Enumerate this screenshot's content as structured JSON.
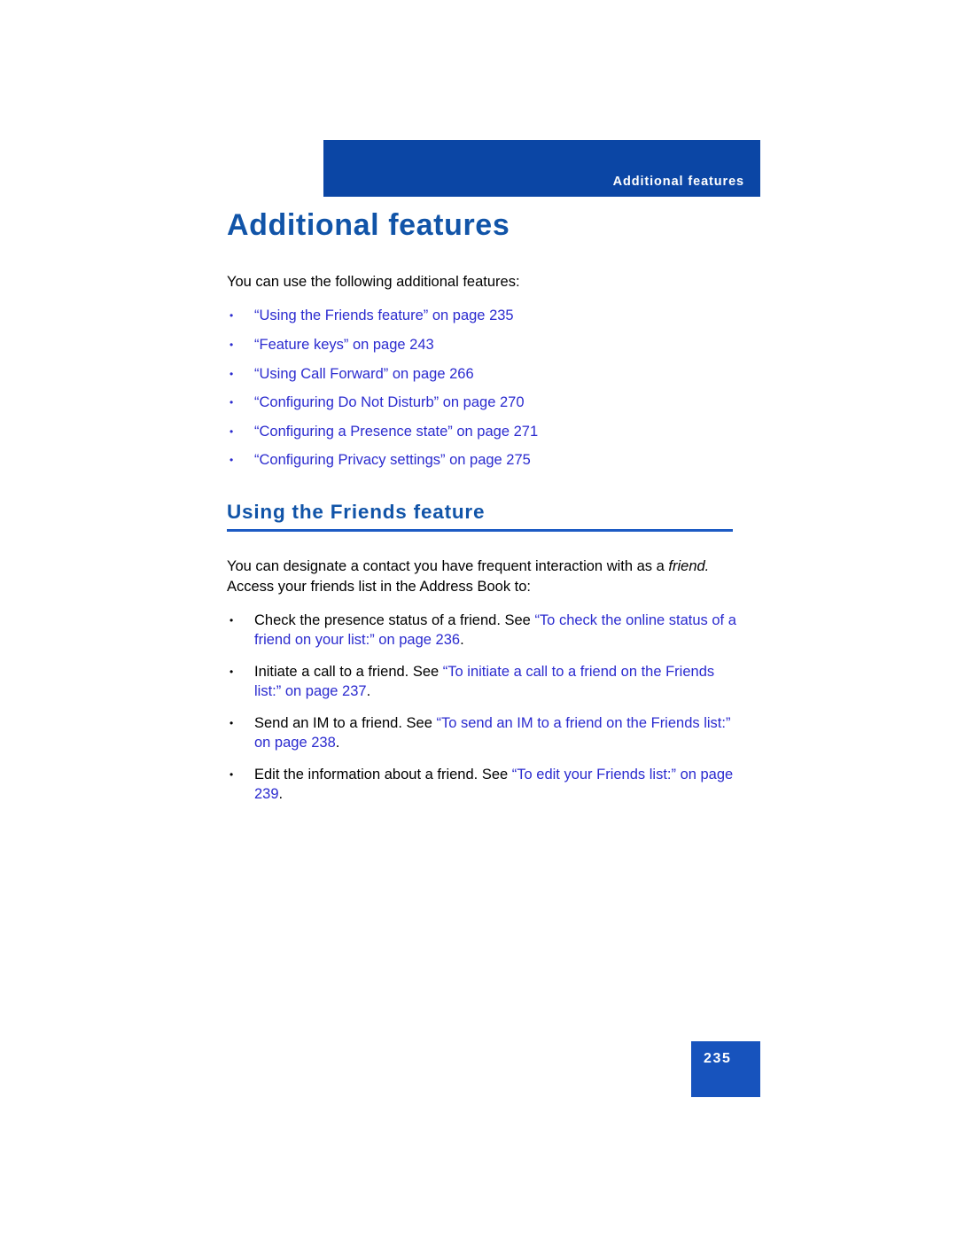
{
  "header": {
    "running_head": "Additional features",
    "band_color": "#0B46A5"
  },
  "page": {
    "title": "Additional features",
    "intro": "You can use the following additional features:",
    "link_color": "#2B2BCF",
    "heading_color": "#1154A8"
  },
  "feature_links": [
    {
      "label": "“Using the Friends feature” on page 235"
    },
    {
      "label": "“Feature keys” on page 243"
    },
    {
      "label": "“Using Call Forward” on page 266"
    },
    {
      "label": "“Configuring Do Not Disturb” on page 270"
    },
    {
      "label": "“Configuring a Presence state” on page 271"
    },
    {
      "label": "“Configuring Privacy settings” on page 275"
    }
  ],
  "section": {
    "heading": "Using the Friends feature",
    "paragraph_part1": "You can designate a contact you have frequent interaction with as a ",
    "paragraph_italic": "friend.",
    "paragraph_part2": " Access your friends list in the Address Book to:"
  },
  "tasks": [
    {
      "lead": "Check the presence status of a friend. See ",
      "xref": "“To check the online status of a friend on your list:” on page 236",
      "tail": "."
    },
    {
      "lead": "Initiate a call to a friend. See ",
      "xref": "“To initiate a call to a friend on the Friends list:” on page 237",
      "tail": "."
    },
    {
      "lead": "Send an IM to a friend. See ",
      "xref": "“To send an IM to a friend on the Friends list:” on page 238",
      "tail": "."
    },
    {
      "lead": "Edit the information about a friend. See ",
      "xref": "“To edit your Friends list:” on page 239",
      "tail": "."
    }
  ],
  "footer": {
    "page_number": "235",
    "box_color": "#1753BD"
  }
}
